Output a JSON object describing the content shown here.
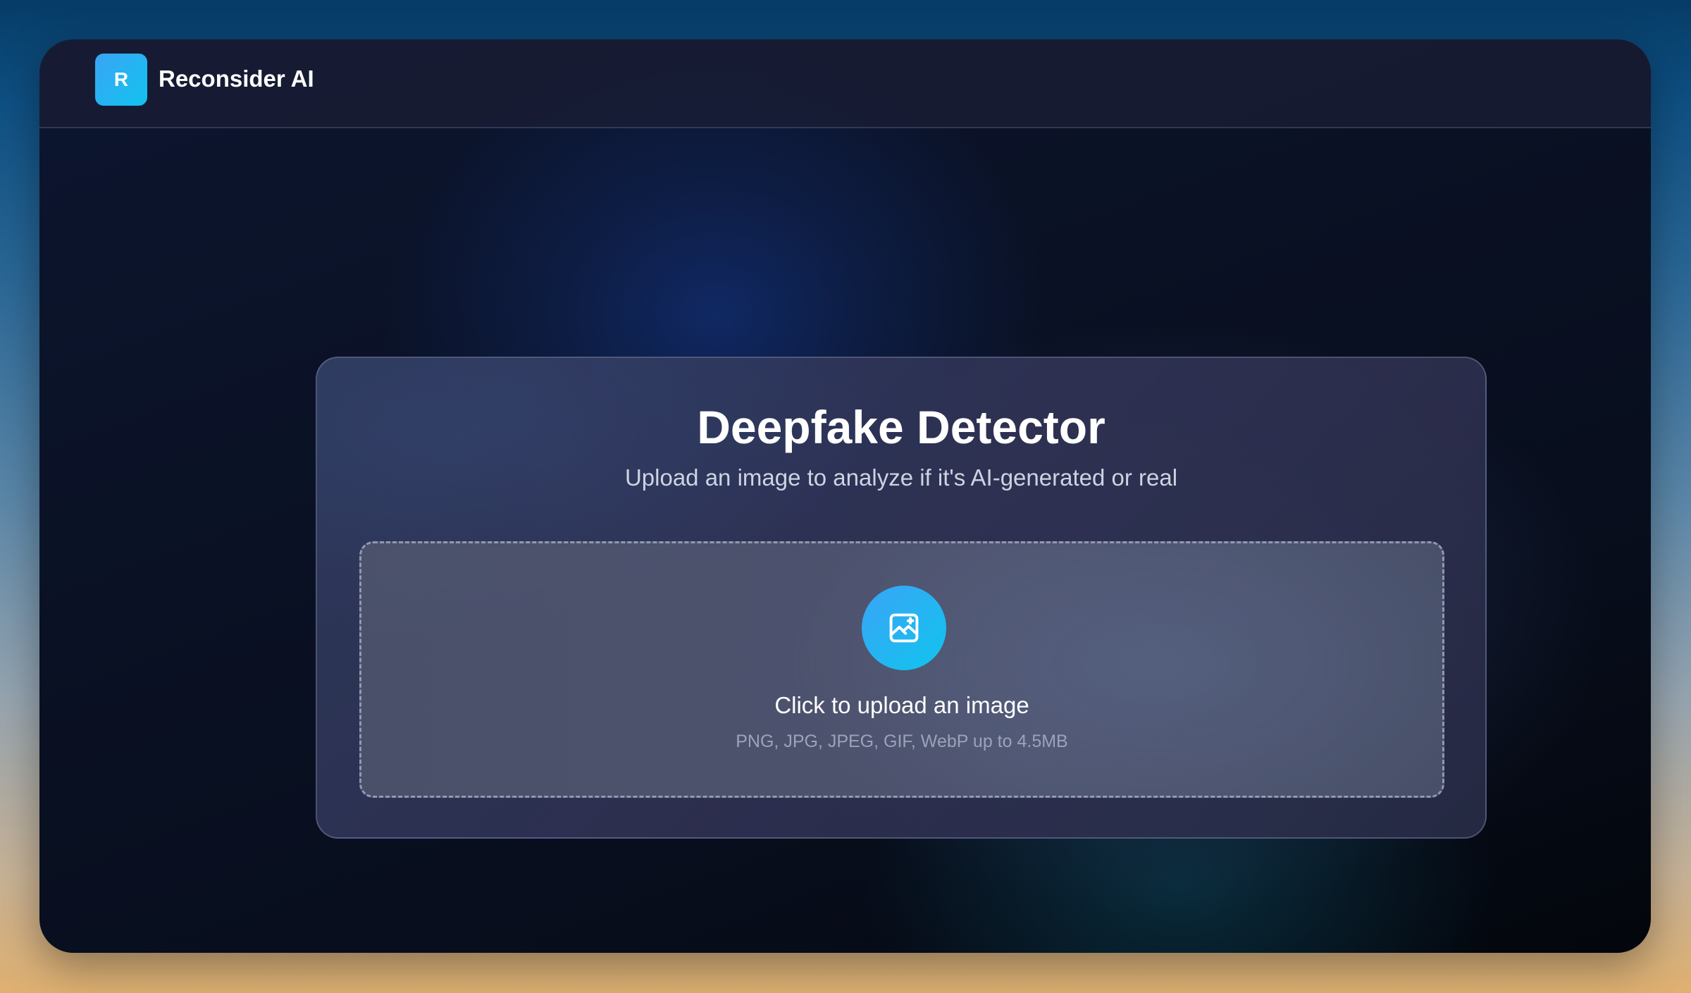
{
  "header": {
    "logo_letter": "R",
    "brand_name": "Reconsider AI"
  },
  "main": {
    "title": "Deepfake Detector",
    "subtitle": "Upload an image to analyze if it's AI-generated or real",
    "upload": {
      "icon": "image-icon",
      "label": "Click to upload an image",
      "hint": "PNG, JPG, JPEG, GIF, WebP up to 4.5MB"
    }
  },
  "colors": {
    "accent_start": "#3aa4f6",
    "accent_end": "#10c4ee",
    "text_primary": "#ffffff",
    "text_secondary": "#cdd3e2",
    "text_muted": "#9ba3b8"
  }
}
